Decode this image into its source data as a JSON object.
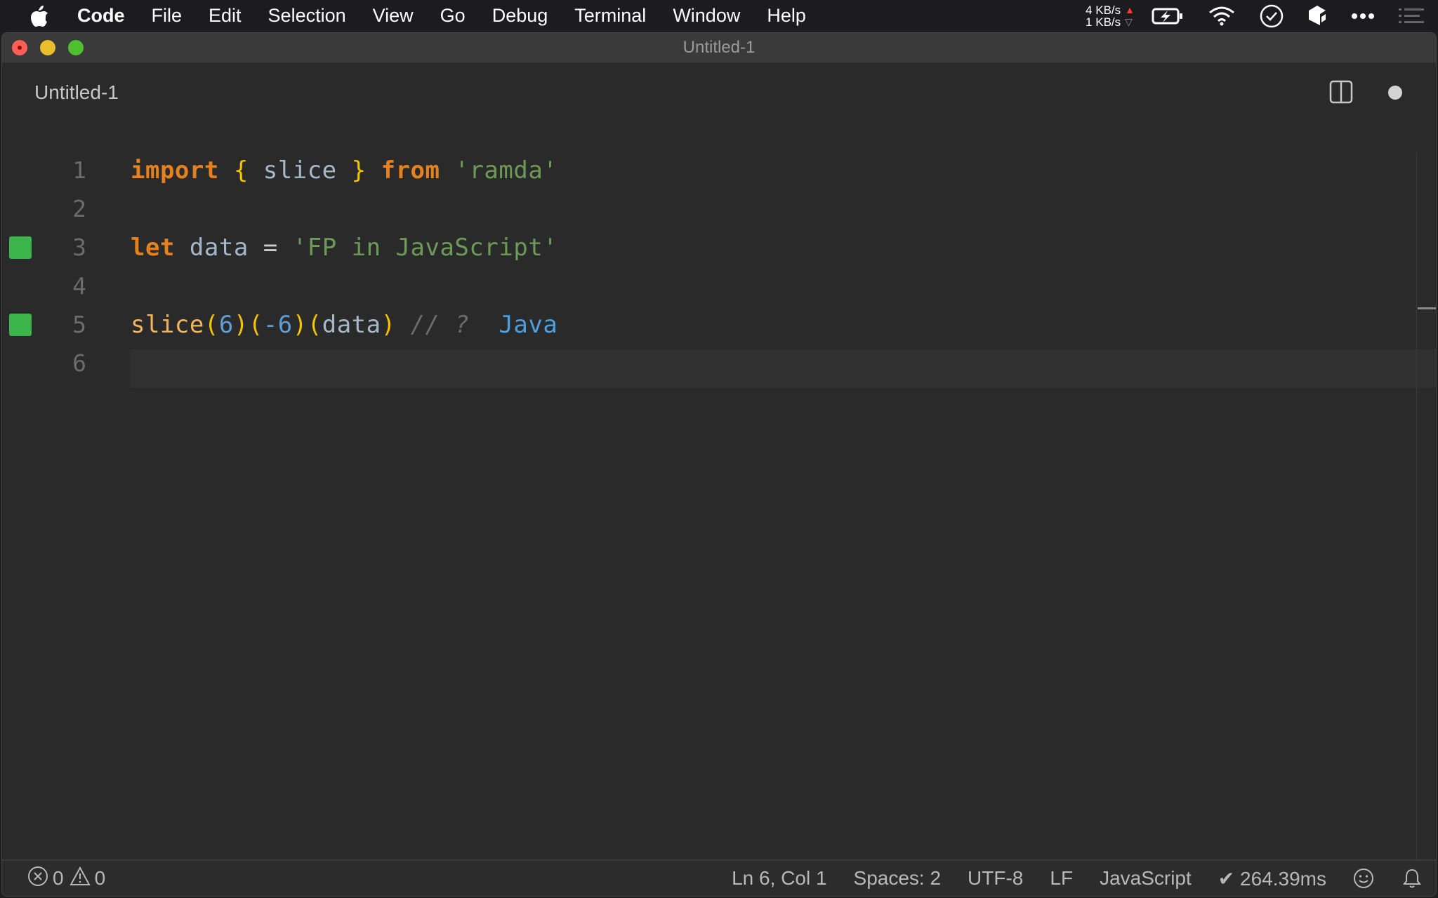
{
  "menubar": {
    "apple_icon": "apple-logo-icon",
    "items": [
      "Code",
      "File",
      "Edit",
      "Selection",
      "View",
      "Go",
      "Debug",
      "Terminal",
      "Window",
      "Help"
    ],
    "network": {
      "upload": "4 KB/s",
      "download": "1 KB/s",
      "up_arrow": "▲",
      "down_arrow": "▽"
    },
    "tray_icons": [
      "battery-charging-icon",
      "wifi-icon",
      "clock-check-icon",
      "app-cube-icon",
      "more-dots-icon",
      "list-menu-icon"
    ]
  },
  "window": {
    "title": "Untitled-1"
  },
  "tab": {
    "title": "Untitled-1",
    "split_icon": "split-editor-icon",
    "dirty_indicator": "unsaved-dot-icon"
  },
  "editor": {
    "lines": [
      {
        "number": "1",
        "marker": false,
        "current": false
      },
      {
        "number": "2",
        "marker": false,
        "current": false
      },
      {
        "number": "3",
        "marker": true,
        "current": false
      },
      {
        "number": "4",
        "marker": false,
        "current": false
      },
      {
        "number": "5",
        "marker": true,
        "current": false
      },
      {
        "number": "6",
        "marker": false,
        "current": true
      }
    ],
    "line1": {
      "import": "import",
      "lbrace": "{",
      "slice": "slice",
      "rbrace": "}",
      "from": "from",
      "module": "'ramda'"
    },
    "line3": {
      "let": "let",
      "name": "data",
      "eq": "=",
      "value": "'FP in JavaScript'"
    },
    "line5": {
      "fn": "slice",
      "p1": "(",
      "a1": "6",
      "p2": ")",
      "p3": "(",
      "a2": "-6",
      "p4": ")",
      "p5": "(",
      "a3": "data",
      "p6": ")",
      "comment": "// ?",
      "result": "Java"
    },
    "marker_color": "#3cb54a"
  },
  "statusbar": {
    "errors": "0",
    "warnings": "0",
    "position": "Ln 6, Col 1",
    "indent": "Spaces: 2",
    "encoding": "UTF-8",
    "eol": "LF",
    "language": "JavaScript",
    "timing": "✔ 264.39ms",
    "feedback_icon": "smiley-icon",
    "notifications_icon": "bell-icon"
  }
}
